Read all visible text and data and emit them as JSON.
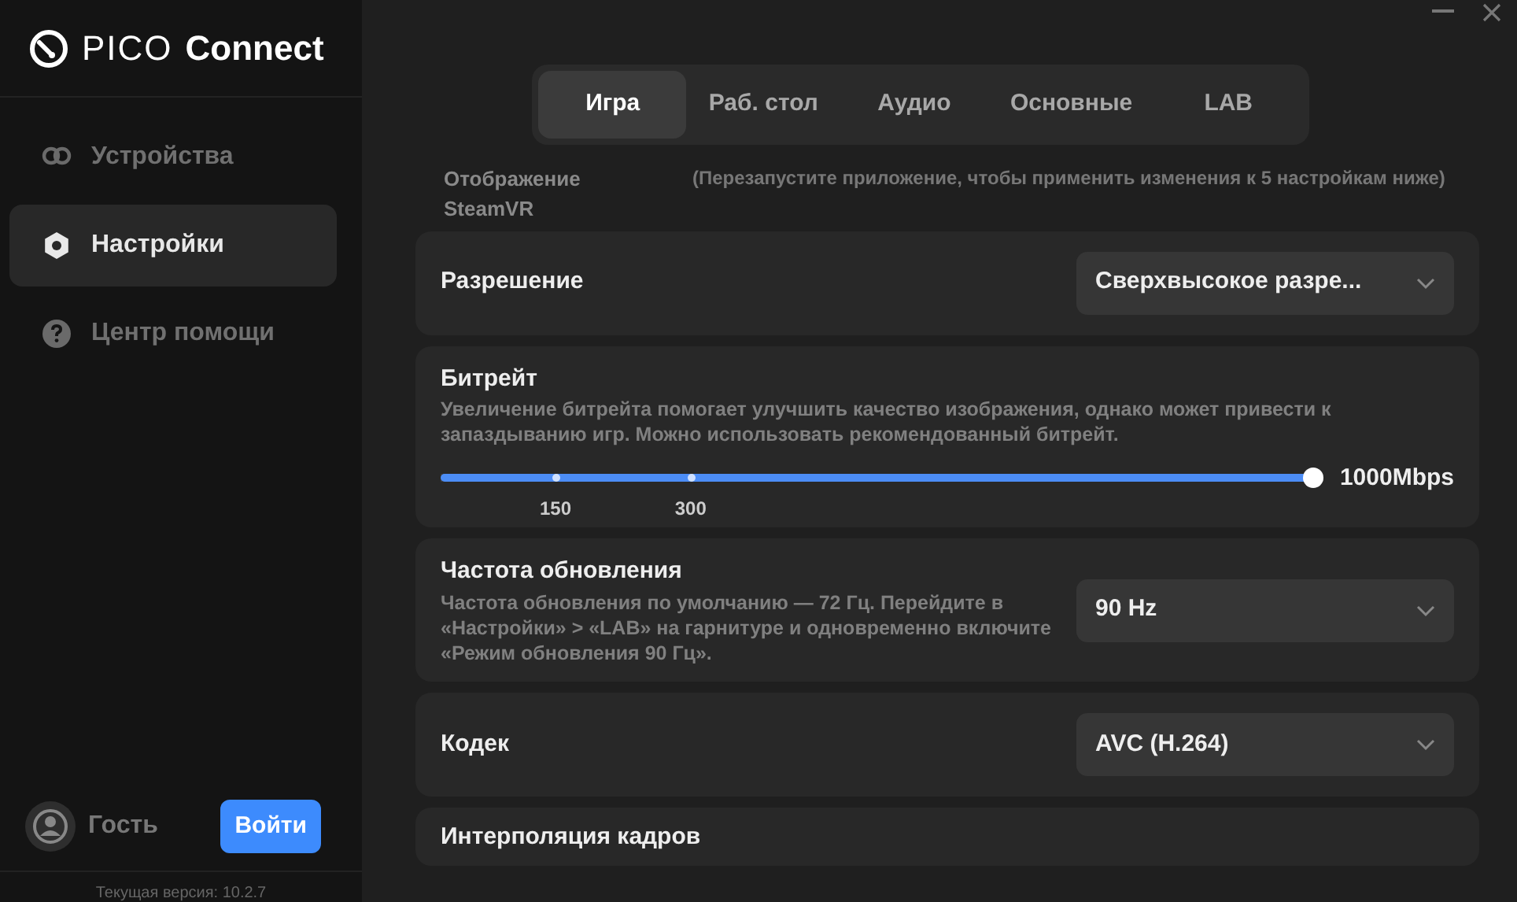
{
  "app": {
    "logo_word_1": "PICO",
    "logo_word_2": "Connect"
  },
  "sidebar": {
    "items": [
      {
        "label": "Устройства",
        "selected": false
      },
      {
        "label": "Настройки",
        "selected": true
      },
      {
        "label": "Центр помощи",
        "selected": false
      }
    ],
    "user": {
      "name": "Гость",
      "button": "Войти"
    },
    "version": "Текущая версия: 10.2.7"
  },
  "tabs": [
    {
      "label": "Игра",
      "selected": true
    },
    {
      "label": "Раб. стол",
      "selected": false
    },
    {
      "label": "Аудио",
      "selected": false
    },
    {
      "label": "Основные",
      "selected": false
    },
    {
      "label": "LAB",
      "selected": false
    }
  ],
  "section": {
    "title": "Отображение SteamVR",
    "note": "(Перезапустите приложение, чтобы применить изменения к 5 настройкам ниже)"
  },
  "settings": [
    {
      "kind": "dropdown",
      "title": "Разрешение",
      "value": "Сверхвысокое разре..."
    },
    {
      "kind": "slider",
      "title": "Битрейт",
      "description": "Увеличение битрейта помогает улучшить качество изображения, однако может привести к запаздыванию игр. Можно использовать рекомендованный битрейт.",
      "level": 1,
      "reading": "1000Mbps",
      "marks": [
        {
          "label": "150",
          "level": 0.13
        },
        {
          "label": "300",
          "level": 0.283
        }
      ]
    },
    {
      "kind": "dropdown",
      "title": "Частота обновления",
      "description": "Частота обновления по умолчанию — 72 Гц. Перейдите в «Настройки» > «LAB» на гарнитуре и одновременно включите «Режим обновления 90 Гц».",
      "value": "90 Hz"
    },
    {
      "kind": "dropdown",
      "title": "Кодек",
      "value": "AVC (H.264)"
    },
    {
      "kind": "heading",
      "title": "Интерполяция кадров"
    }
  ]
}
